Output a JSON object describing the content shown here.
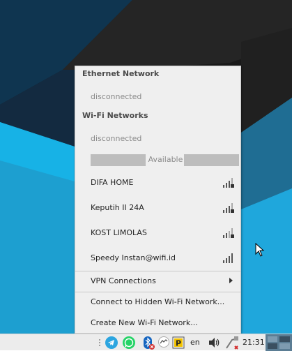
{
  "menu": {
    "ethernet_header": "Ethernet Network",
    "ethernet_status": "disconnected",
    "wifi_header": "Wi-Fi Networks",
    "wifi_status": "disconnected",
    "available_label": "Available",
    "networks": [
      {
        "name": "DIFA HOME",
        "signal_icon": "wifi-signal-locked-icon"
      },
      {
        "name": "Keputih II 24A",
        "signal_icon": "wifi-signal-locked-icon"
      },
      {
        "name": "KOST LIMOLAS",
        "signal_icon": "wifi-signal-locked-icon"
      },
      {
        "name": "Speedy Instan@wifi.id",
        "signal_icon": "wifi-signal-icon"
      }
    ],
    "vpn_label": "VPN Connections",
    "hidden_label": "Connect to Hidden Wi-Fi Network...",
    "create_label": "Create New Wi-Fi Network..."
  },
  "taskbar": {
    "language": "en",
    "clock": "21:31",
    "icons": [
      "telegram-icon",
      "whatsapp-icon",
      "bluetooth-icon",
      "messenger-icon",
      "p-app-icon",
      "volume-icon",
      "network-icon"
    ]
  },
  "colors": {
    "menu_bg": "#efefef",
    "desktop_blue": "#1d9fd0",
    "desktop_dark": "#2a2a2a",
    "telegram": "#2ca5e0",
    "whatsapp": "#25d366",
    "bluetooth": "#1565c0",
    "error_badge": "#d32f2f"
  }
}
